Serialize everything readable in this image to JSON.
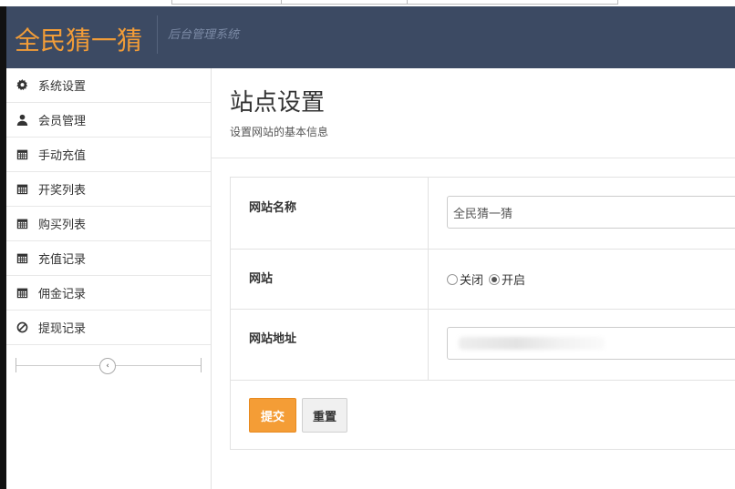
{
  "header": {
    "brand": "全民猜一猜",
    "subtitle": "后台管理系统"
  },
  "sidebar": {
    "items": [
      {
        "label": "系统设置",
        "icon": "gear-icon"
      },
      {
        "label": "会员管理",
        "icon": "user-icon"
      },
      {
        "label": "手动充值",
        "icon": "calendar-icon"
      },
      {
        "label": "开奖列表",
        "icon": "calendar-icon"
      },
      {
        "label": "购买列表",
        "icon": "calendar-icon"
      },
      {
        "label": "充值记录",
        "icon": "calendar-icon"
      },
      {
        "label": "佣金记录",
        "icon": "calendar-icon"
      },
      {
        "label": "提现记录",
        "icon": "ban-icon"
      }
    ],
    "collapse_glyph": "‹"
  },
  "page": {
    "title": "站点设置",
    "subtitle": "设置网站的基本信息"
  },
  "form": {
    "site_name_label": "网站名称",
    "site_name_value": "全民猜一猜",
    "site_label": "网站",
    "site_option_off": "关闭",
    "site_option_on": "开启",
    "site_selected": "开启",
    "site_url_label": "网站地址",
    "submit_label": "提交",
    "reset_label": "重置"
  },
  "colors": {
    "header_bg": "#3c4a63",
    "brand": "#f19c38",
    "submit_bg": "#f49d36"
  }
}
